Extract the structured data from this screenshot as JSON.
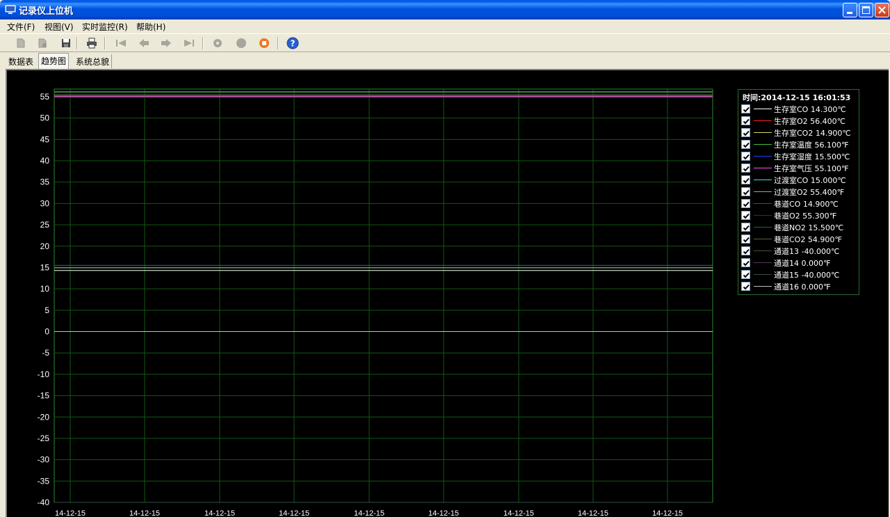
{
  "window": {
    "title": "记录仪上位机"
  },
  "menu": [
    {
      "label": "文件(F)"
    },
    {
      "label": "视图(V)"
    },
    {
      "label": "实时监控(R)"
    },
    {
      "label": "帮助(H)"
    }
  ],
  "toolbar": {
    "icons": [
      "open-icon",
      "find-icon",
      "save-icon",
      "print-icon",
      "first-icon",
      "prev-icon",
      "next-icon",
      "last-icon",
      "gear-icon",
      "record-icon",
      "stop-icon",
      "help-icon"
    ]
  },
  "tabs": [
    {
      "label": "数据表"
    },
    {
      "label": "趋势图"
    },
    {
      "label": "系统总貌"
    }
  ],
  "colors": {
    "background": "#000000",
    "grid": "#0F5A0F",
    "axis": "#2D8A2D",
    "axis_text": "#FFFFFF"
  },
  "legend": {
    "time": "时间:2014-12-15 16:01:53",
    "items": [
      {
        "label": "生存室CO 14.300℃",
        "color": "#FFFFFF"
      },
      {
        "label": "生存室O2 56.400℃",
        "color": "#FF2020"
      },
      {
        "label": "生存室CO2 14.900℃",
        "color": "#D8D860"
      },
      {
        "label": "生存室温度 56.100℉",
        "color": "#40C040"
      },
      {
        "label": "生存室湿度 15.500℃",
        "color": "#2040FF"
      },
      {
        "label": "生存室气压 55.100℉",
        "color": "#FF50FF"
      },
      {
        "label": "过渡室CO 15.000℃",
        "color": "#40E0E0"
      },
      {
        "label": "过渡室O2 55.400℉",
        "color": "#A0A0A0"
      },
      {
        "label": "巷道CO 14.900℃",
        "color": "#306030"
      },
      {
        "label": "巷道O2 55.300℉",
        "color": "#602020"
      },
      {
        "label": "巷道NO2 15.500℃",
        "color": "#206060"
      },
      {
        "label": "巷道CO2 54.900℉",
        "color": "#606030"
      },
      {
        "label": "通道13 -40.000℃",
        "color": "#505030"
      },
      {
        "label": "通道14 0.000℉",
        "color": "#603060"
      },
      {
        "label": "通道15 -40.000℃",
        "color": "#305050"
      },
      {
        "label": "通道16 0.000℉",
        "color": "#C0C0C0"
      }
    ]
  },
  "chart_data": {
    "type": "line",
    "ylim": [
      -40,
      55
    ],
    "y_ticks": [
      "55",
      "50",
      "45",
      "40",
      "35",
      "30",
      "25",
      "20",
      "15",
      "10",
      "5",
      "0",
      "-5",
      "-10",
      "-15",
      "-20",
      "-25",
      "-30",
      "-35",
      "-40"
    ],
    "x_ticks": [
      "14-12-15",
      "14-12-15",
      "14-12-15",
      "14-12-15",
      "14-12-15",
      "14-12-15",
      "14-12-15",
      "14-12-15",
      "14-12-15"
    ],
    "grid": true,
    "legend_position": "right",
    "series": [
      {
        "name": "生存室CO 14.300℃",
        "value": 14.3,
        "color": "#FFFFFF"
      },
      {
        "name": "生存室O2 56.400℃",
        "value": 56.4,
        "color": "#FF2020"
      },
      {
        "name": "生存室CO2 14.900℃",
        "value": 14.9,
        "color": "#D8D860"
      },
      {
        "name": "生存室温度 56.100℉",
        "value": 56.1,
        "color": "#40C040"
      },
      {
        "name": "生存室湿度 15.500℃",
        "value": 15.5,
        "color": "#2040FF"
      },
      {
        "name": "生存室气压 55.100℉",
        "value": 55.1,
        "color": "#FF50FF"
      },
      {
        "name": "过渡室CO 15.000℃",
        "value": 15.0,
        "color": "#40E0E0"
      },
      {
        "name": "过渡室O2 55.400℉",
        "value": 55.4,
        "color": "#A0A0A0"
      },
      {
        "name": "巷道CO 14.900℃",
        "value": 14.9,
        "color": "#306030"
      },
      {
        "name": "巷道O2 55.300℉",
        "value": 55.3,
        "color": "#602020"
      },
      {
        "name": "巷道NO2 15.500℃",
        "value": 15.5,
        "color": "#206060"
      },
      {
        "name": "巷道CO2 54.900℉",
        "value": 54.9,
        "color": "#606030"
      },
      {
        "name": "通道13 -40.000℃",
        "value": -40.0,
        "color": "#505030"
      },
      {
        "name": "通道14 0.000℉",
        "value": 0.0,
        "color": "#603060"
      },
      {
        "name": "通道15 -40.000℃",
        "value": -40.0,
        "color": "#305050"
      },
      {
        "name": "通道16 0.000℉",
        "value": 0.0,
        "color": "#C0C0C0"
      }
    ]
  }
}
